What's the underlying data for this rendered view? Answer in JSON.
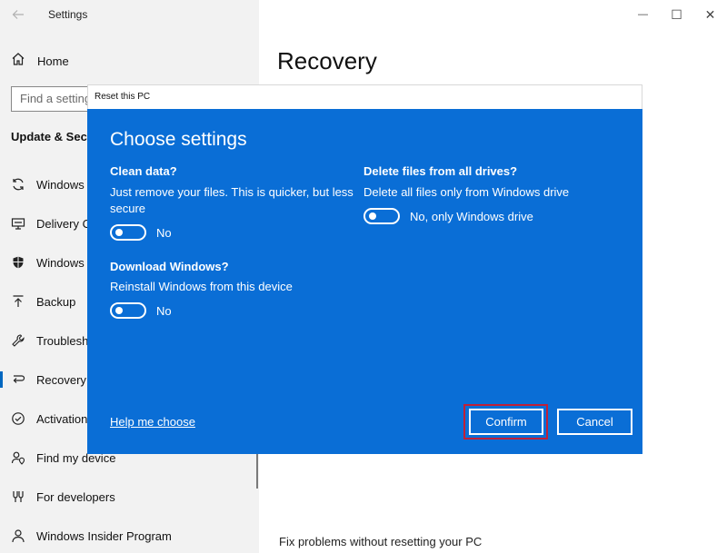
{
  "window": {
    "app_title": "Settings",
    "controls": {
      "minimize": "—",
      "maximize": "☐",
      "close": "✕"
    }
  },
  "sidebar": {
    "home_label": "Home",
    "search_placeholder": "Find a setting",
    "section_title": "Update & Security",
    "items": [
      {
        "label": "Windows Update",
        "icon": "sync-icon"
      },
      {
        "label": "Delivery Optimization",
        "icon": "delivery-icon"
      },
      {
        "label": "Windows Security",
        "icon": "shield-icon"
      },
      {
        "label": "Backup",
        "icon": "upload-icon"
      },
      {
        "label": "Troubleshoot",
        "icon": "wrench-icon"
      },
      {
        "label": "Recovery",
        "icon": "recovery-icon",
        "active": true
      },
      {
        "label": "Activation",
        "icon": "check-circle-icon"
      },
      {
        "label": "Find my device",
        "icon": "person-location-icon"
      },
      {
        "label": "For developers",
        "icon": "developer-icon"
      },
      {
        "label": "Windows Insider Program",
        "icon": "insider-icon"
      }
    ]
  },
  "main": {
    "heading": "Recovery",
    "bottom_text": "Fix problems without resetting your PC"
  },
  "dialog": {
    "window_title": "Reset this PC",
    "heading": "Choose settings",
    "options": {
      "clean_data": {
        "title": "Clean data?",
        "desc_line1": "Just remove your files. This is quicker, but less",
        "desc_line2": "secure",
        "toggle_label": "No",
        "state": "off"
      },
      "download_windows": {
        "title": "Download Windows?",
        "desc": "Reinstall Windows from this device",
        "toggle_label": "No",
        "state": "off"
      },
      "delete_all_drives": {
        "title": "Delete files from all drives?",
        "desc": "Delete all files only from Windows drive",
        "toggle_label": "No, only Windows drive",
        "state": "off"
      }
    },
    "help_link": "Help me choose",
    "confirm_label": "Confirm",
    "cancel_label": "Cancel"
  },
  "colors": {
    "dialog_bg": "#0a6ed6",
    "sidebar_bg": "#f2f2f2",
    "highlight": "#c02038",
    "accent": "#0067c0"
  }
}
